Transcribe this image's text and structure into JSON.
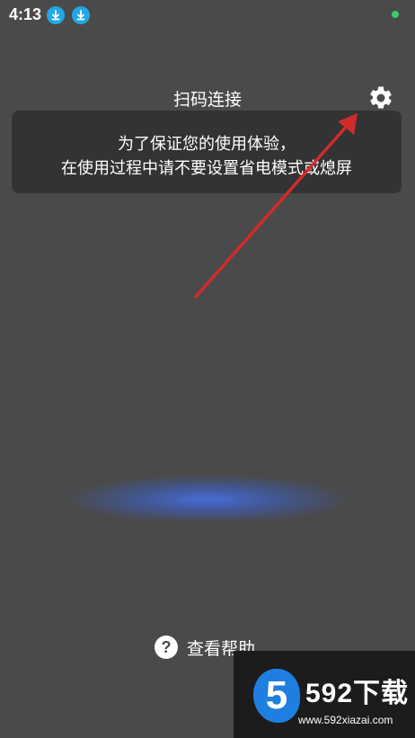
{
  "status_bar": {
    "time": "4:13",
    "notification_icons": [
      "download-icon",
      "download-icon"
    ],
    "dot_color": "#3ccb6c"
  },
  "header": {
    "title": "扫码连接",
    "settings_icon": "gear-icon"
  },
  "toast": {
    "line1": "为了保证您的使用体验，",
    "line2": "在使用过程中请不要设置省电模式或熄屏"
  },
  "help": {
    "icon_glyph": "?",
    "label": "查看帮助"
  },
  "watermark": {
    "logo_glyph": "5",
    "title": "592下载",
    "url": "www.592xiazai.com"
  },
  "colors": {
    "background": "#4a4a4a",
    "toast_background": "#333333",
    "arrow": "#d22b2b",
    "scan_glow": "#466edc",
    "download_badge": "#21a8e6"
  }
}
